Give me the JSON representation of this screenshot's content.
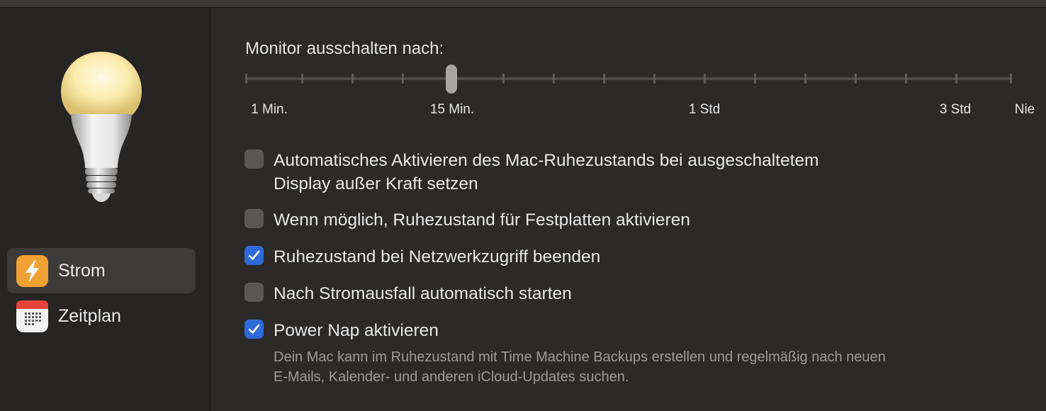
{
  "sidebar": {
    "items": [
      {
        "label": "Strom",
        "icon": "lightning-bolt-icon",
        "active": true,
        "icon_color": "#f0a235"
      },
      {
        "label": "Zeitplan",
        "icon": "calendar-icon",
        "active": false,
        "icon_color": "#f2f2f2"
      }
    ]
  },
  "display_sleep": {
    "title": "Monitor ausschalten nach:",
    "tick_labels": [
      "1 Min.",
      "15 Min.",
      "1 Std",
      "3 Std",
      "Nie"
    ],
    "selected": "15 Min."
  },
  "options": [
    {
      "line1": "Automatisches Aktivieren des Mac-Ruhezustands bei ausgeschaltetem",
      "line2": "Display außer Kraft setzen",
      "checked": false
    },
    {
      "label": "Wenn möglich, Ruhezustand für Festplatten aktivieren",
      "checked": false
    },
    {
      "label": "Ruhezustand bei Netzwerkzugriff beenden",
      "checked": true
    },
    {
      "label": "Nach Stromausfall automatisch starten",
      "checked": false
    },
    {
      "label": "Power Nap aktivieren",
      "checked": true,
      "desc1": "Dein Mac kann im Ruhezustand mit Time Machine Backups erstellen und regelmäßig nach neuen",
      "desc2": "E-Mails, Kalender- und anderen iCloud-Updates suchen."
    }
  ],
  "colors": {
    "accent": "#2e6ad8",
    "background": "#2b2a29",
    "sidebar": "#262524"
  }
}
